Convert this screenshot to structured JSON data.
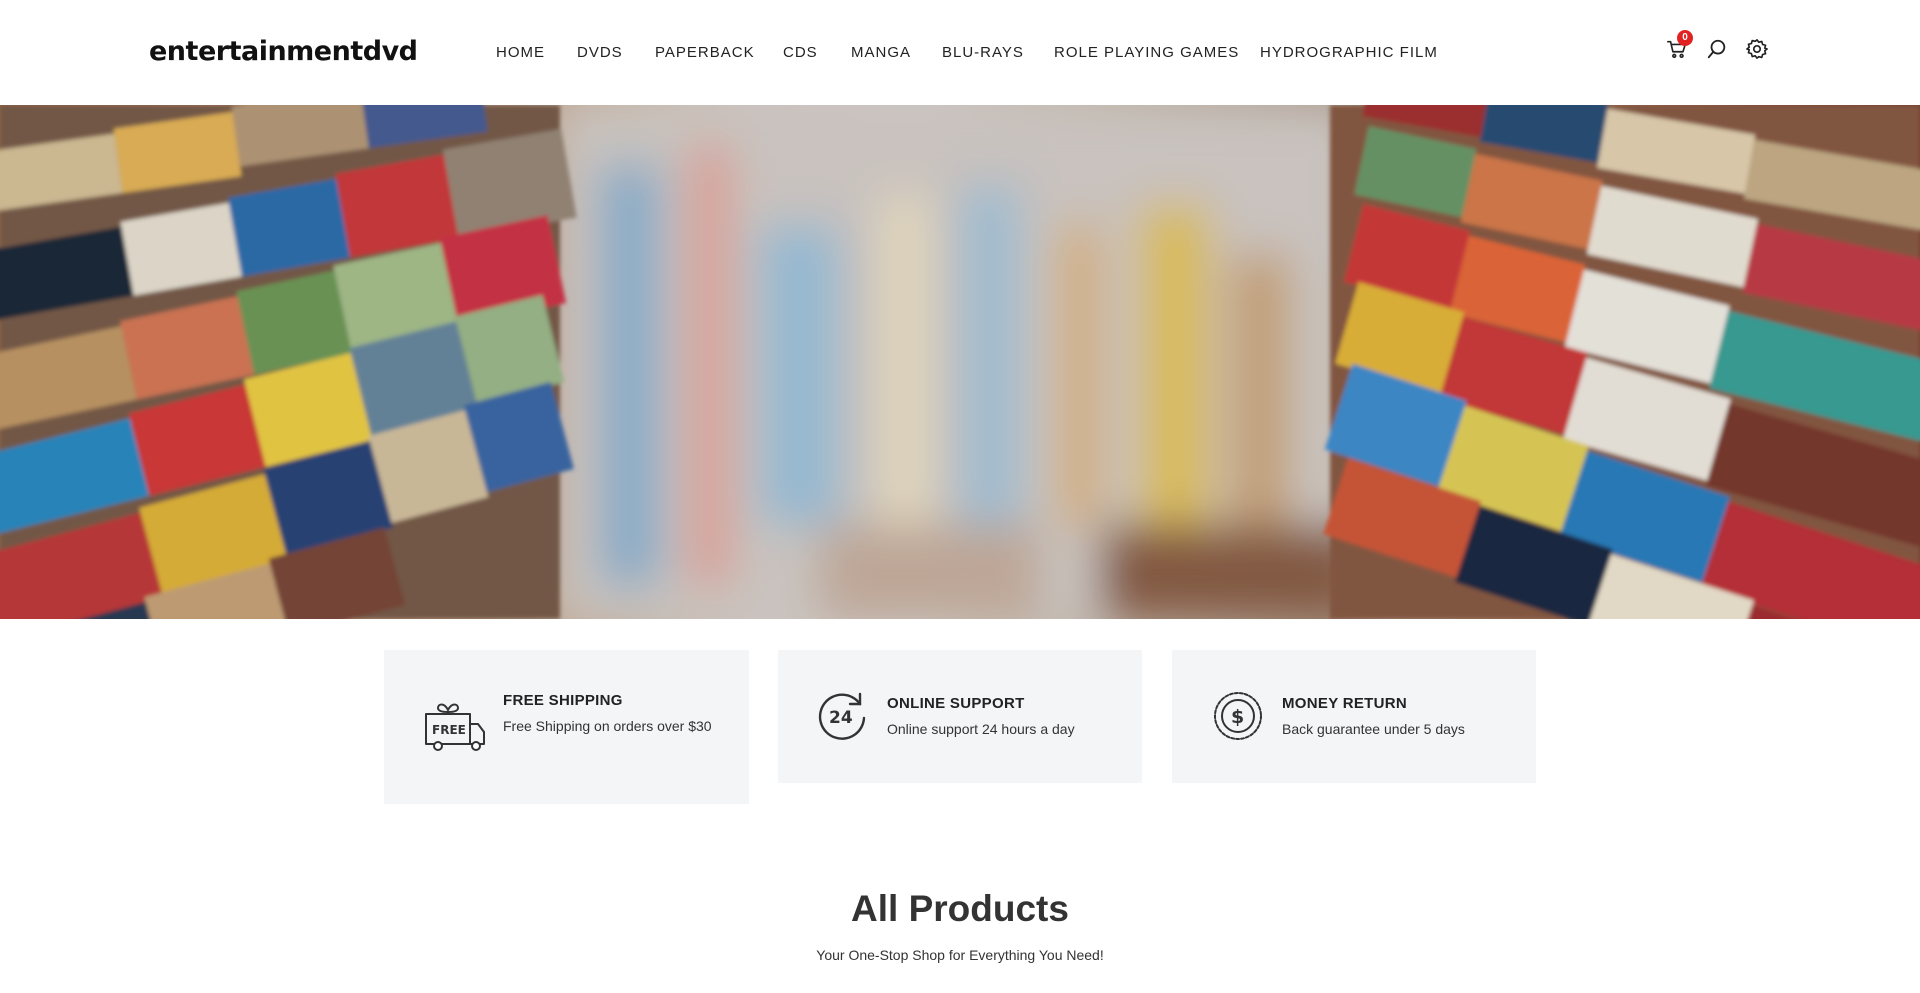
{
  "header": {
    "logo": "entertainmentdvd",
    "nav": [
      "HOME",
      "DVDS",
      "PAPERBACK",
      "CDS",
      "MANGA",
      "BLU-RAYS",
      "ROLE PLAYING GAMES",
      "HYDROGRAPHIC FILM"
    ],
    "cart_count": "0",
    "icons": [
      "cart-icon",
      "search-icon",
      "gear-icon"
    ]
  },
  "hero": {
    "image": "blurred stacks of colorful books"
  },
  "features": [
    {
      "icon": "free-delivery-truck-icon",
      "title": "FREE SHIPPING",
      "desc": "Free Shipping on orders over $30"
    },
    {
      "icon": "24-hour-support-icon",
      "title": "ONLINE SUPPORT",
      "desc": "Online support 24 hours a day"
    },
    {
      "icon": "money-return-icon",
      "title": "MONEY RETURN",
      "desc": "Back guarantee under 5 days"
    }
  ],
  "products_section": {
    "title": "All Products",
    "subtitle": "Your One-Stop Shop for Everything You Need!"
  }
}
